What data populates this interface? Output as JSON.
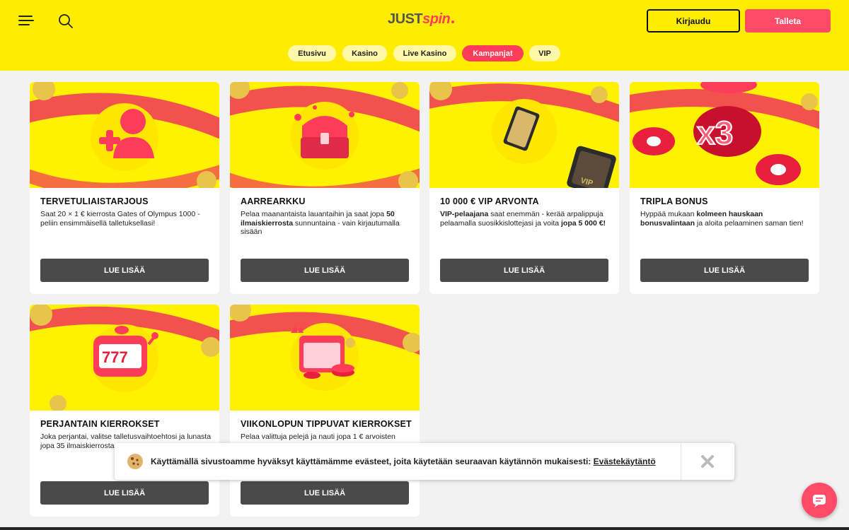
{
  "header": {
    "logo_just": "JUST",
    "logo_spin": "spin",
    "login_label": "Kirjaudu",
    "deposit_label": "Talleta"
  },
  "nav": {
    "items": [
      {
        "label": "Etusivu",
        "active": false
      },
      {
        "label": "Kasino",
        "active": false
      },
      {
        "label": "Live Kasino",
        "active": false
      },
      {
        "label": "Kampanjat",
        "active": true
      },
      {
        "label": "VIP",
        "active": false
      }
    ]
  },
  "promotions": [
    {
      "title": "TERVETULIAISTARJOUS",
      "description_parts": [
        {
          "text": "Saat 20 × 1 € kierrosta Gates of Olympus 1000 -peliin ensimmäisellä talletuksellasi!",
          "bold": false
        }
      ],
      "button": "LUE LISÄÄ",
      "icon": "add-user-icon"
    },
    {
      "title": "AARREARKKU",
      "description_parts": [
        {
          "text": "Pelaa maanantaista lauantaihin ja saat jopa ",
          "bold": false
        },
        {
          "text": "50 ilmaiskierrosta",
          "bold": true
        },
        {
          "text": " sunnuntaina - vain kirjautumalla sisään",
          "bold": false
        }
      ],
      "button": "LUE LISÄÄ",
      "icon": "treasure-chest-icon"
    },
    {
      "title": "10 000 € VIP ARVONTA",
      "description_parts": [
        {
          "text": "VIP-pelaajana",
          "bold": true
        },
        {
          "text": " saat enemmän - kerää arpalippuja pelaamalla suosikkislottejasi ja voita ",
          "bold": false
        },
        {
          "text": "jopa 5 000 €!",
          "bold": true
        }
      ],
      "button": "LUE LISÄÄ",
      "icon": "vip-ticket-icon",
      "image_text": "VIP"
    },
    {
      "title": "TRIPLA BONUS",
      "description_parts": [
        {
          "text": "Hyppää mukaan ",
          "bold": false
        },
        {
          "text": "kolmeen hauskaan bonusvalintaan",
          "bold": true
        },
        {
          "text": " ja aloita pelaaminen saman tien!",
          "bold": false
        }
      ],
      "button": "LUE LISÄÄ",
      "icon": "x3-multiplier-icon",
      "image_text": "x3"
    },
    {
      "title": "PERJANTAIN KIERROKSET",
      "description_parts": [
        {
          "text": "Joka perjantai, valitse talletusvaihtoehtosi ja lunasta jopa 35 ilmaiskierrosta",
          "bold": false
        }
      ],
      "button": "LUE LISÄÄ",
      "icon": "slot-machine-icon",
      "image_text": "777"
    },
    {
      "title": "VIIKONLOPUN TIPPUVAT KIERROKSET",
      "description_parts": [
        {
          "text": "Pelaa valittuja pelejä ja nauti jopa 1 € arvoisten",
          "bold": false
        }
      ],
      "button": "LUE LISÄÄ",
      "icon": "calendar-chips-icon"
    }
  ],
  "cookie_banner": {
    "text": "Käyttämällä sivustoamme hyväksyt käyttämämme evästeet, joita käytetään seuraavan käytännön mukaisesti: ",
    "link": "Evästekäytäntö"
  },
  "colors": {
    "brand_yellow": "#ffed00",
    "brand_red": "#ff3d5a",
    "button_dark": "#4a4a4a"
  }
}
